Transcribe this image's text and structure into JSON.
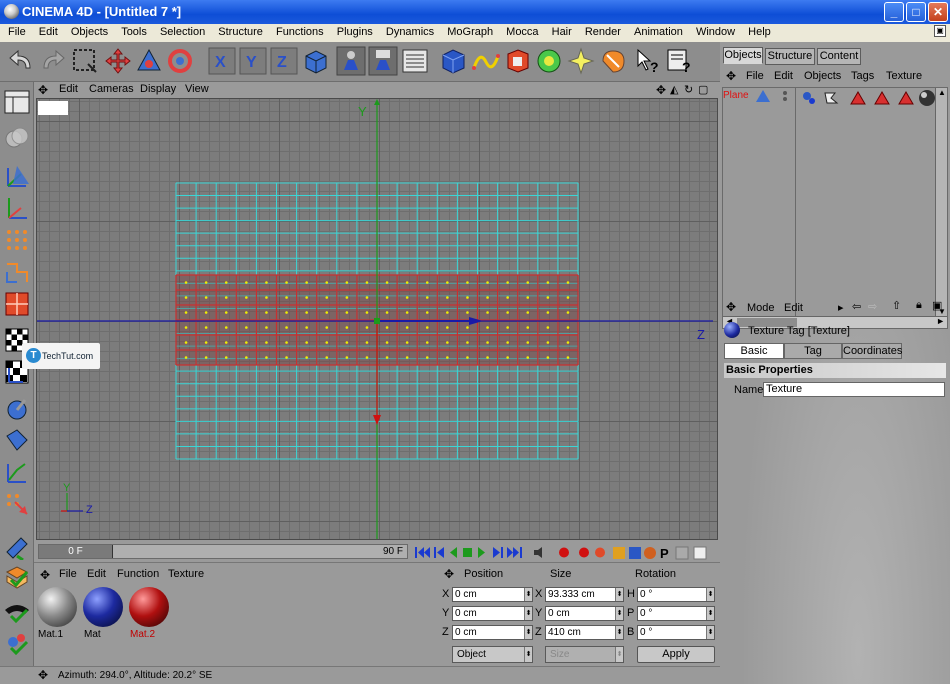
{
  "window": {
    "title": "CINEMA 4D - [Untitled 7 *]",
    "buttons": {
      "minimize": "_",
      "maximize": "□",
      "close": "✕"
    }
  },
  "menubar": [
    "File",
    "Edit",
    "Objects",
    "Tools",
    "Selection",
    "Structure",
    "Functions",
    "Plugins",
    "Dynamics",
    "MoGraph",
    "Mocca",
    "Hair",
    "Render",
    "Animation",
    "Window",
    "Help"
  ],
  "viewport": {
    "menu": [
      "Edit",
      "Cameras",
      "Display",
      "View"
    ],
    "axis_labels": {
      "y": "Y",
      "z": "Z"
    },
    "gizmo": {
      "y": "Y",
      "z": "Z"
    },
    "watermark": "TechTut.com"
  },
  "timeline": {
    "start_frame": "0 F",
    "end_frame": "90 F"
  },
  "materials": {
    "menu": [
      "File",
      "Edit",
      "Function",
      "Texture"
    ],
    "items": [
      {
        "name": "Mat.1",
        "color": "#7a7a7a"
      },
      {
        "name": "Mat",
        "color": "#1d2aa0"
      },
      {
        "name": "Mat.2",
        "color": "#b01010",
        "selected": true
      }
    ]
  },
  "coordinates": {
    "headers": [
      "Position",
      "Size",
      "Rotation"
    ],
    "rows": [
      {
        "pos_axis": "X",
        "pos": "0 cm",
        "size_axis": "X",
        "size": "93.333 cm",
        "rot_axis": "H",
        "rot": "0 °"
      },
      {
        "pos_axis": "Y",
        "pos": "0 cm",
        "size_axis": "Y",
        "size": "0 cm",
        "rot_axis": "P",
        "rot": "0 °"
      },
      {
        "pos_axis": "Z",
        "pos": "0 cm",
        "size_axis": "Z",
        "size": "410 cm",
        "rot_axis": "B",
        "rot": "0 °"
      }
    ],
    "mode_select": "Object",
    "size_select": "Size",
    "apply_label": "Apply"
  },
  "statusbar": {
    "text": "Azimuth: 294.0°, Altitude: 20.2°  SE"
  },
  "object_manager": {
    "tabs": [
      "Objects",
      "Structure",
      "Content"
    ],
    "menu": [
      "File",
      "Edit",
      "Objects",
      "Tags",
      "Texture"
    ],
    "objects": [
      {
        "name": "Plane"
      }
    ]
  },
  "attribute_manager": {
    "menu": [
      "Mode",
      "Edit"
    ],
    "title": "Texture Tag [Texture]",
    "tabs": [
      "Basic",
      "Tag",
      "Coordinates"
    ],
    "section": "Basic Properties",
    "name_label": "Name",
    "name_value": "Texture"
  },
  "colors": {
    "selected_mesh": "#c83030",
    "cyan_mesh": "#39d6d6",
    "points": "#f0f000",
    "z_axis": "#1a1aa8",
    "y_axis": "#1c9a1c"
  }
}
